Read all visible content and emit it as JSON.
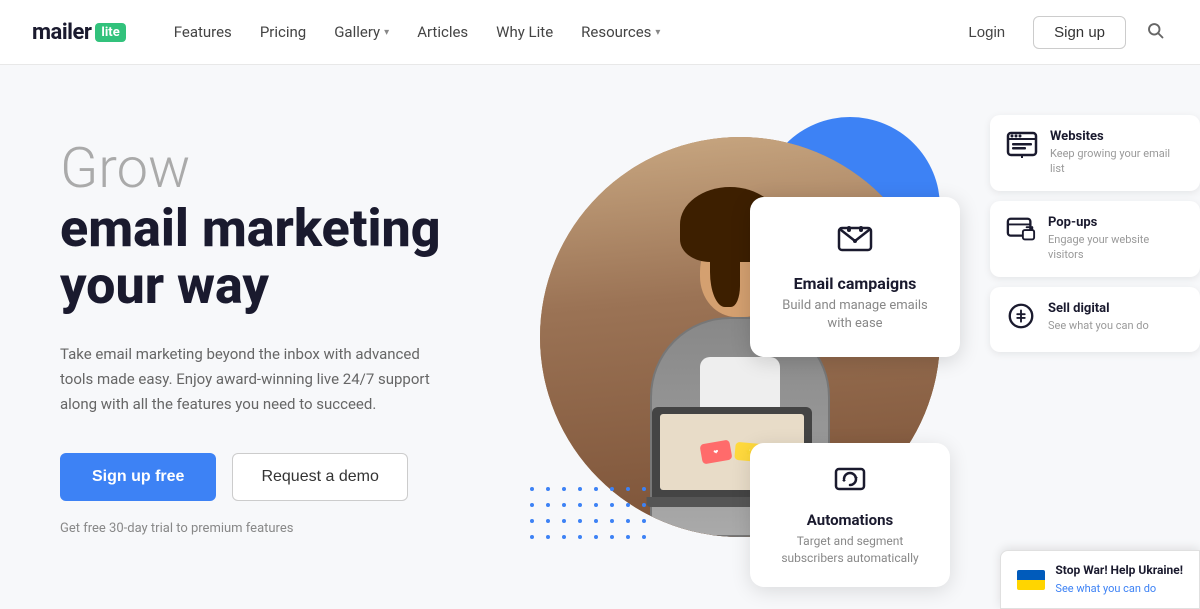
{
  "nav": {
    "logo_text": "mailer",
    "logo_badge": "lite",
    "links": [
      {
        "label": "Features",
        "has_dropdown": false
      },
      {
        "label": "Pricing",
        "has_dropdown": false
      },
      {
        "label": "Gallery",
        "has_dropdown": true
      },
      {
        "label": "Articles",
        "has_dropdown": false
      },
      {
        "label": "Why Lite",
        "has_dropdown": false
      },
      {
        "label": "Resources",
        "has_dropdown": true
      }
    ],
    "login_label": "Login",
    "signup_label": "Sign up"
  },
  "hero": {
    "grow_text": "Grow",
    "title_line1": "email marketing",
    "title_line2": "your way",
    "description": "Take email marketing beyond the inbox with advanced tools made easy. Enjoy award-winning live 24/7 support along with all the features you need to succeed.",
    "btn_primary": "Sign up free",
    "btn_secondary": "Request a demo",
    "trial_text": "Get free 30-day trial to premium features"
  },
  "feature_cards": {
    "email_campaigns": {
      "icon": "✉",
      "title": "Email campaigns",
      "desc": "Build and manage emails with ease"
    },
    "automations": {
      "icon": "🔄",
      "title": "Automations",
      "desc": "Target and segment subscribers automatically"
    }
  },
  "sidebar_cards": [
    {
      "icon": "🌐",
      "title": "Websites",
      "desc": "Keep growing your email list"
    },
    {
      "icon": "💬",
      "title": "Pop-ups",
      "desc": "Engage your website visitors"
    },
    {
      "icon": "🛒",
      "title": "Sell digital",
      "desc": "See what you can do"
    }
  ],
  "ukraine_banner": {
    "title": "Stop War! Help Ukraine!",
    "link_text": "See what you can do"
  }
}
